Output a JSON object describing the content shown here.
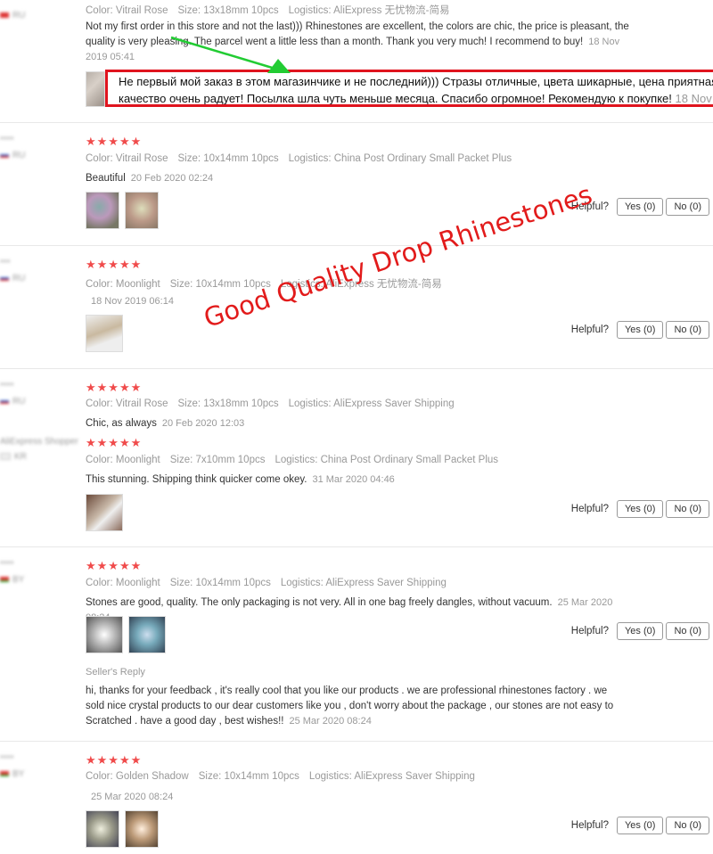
{
  "colors": {
    "star": "#f04b4b",
    "annotation": "#e0141e",
    "arrow": "#22cc33"
  },
  "helpful_label": "Helpful?",
  "reviews": [
    {
      "country": "RU",
      "stars": "",
      "color": "Color: Vitrail Rose",
      "size": "Size: 13x18mm 10pcs",
      "logistics": "Logistics: AliExpress 无忧物流-简易",
      "text": "Not my first order in this store and not the last))) Rhinestones are excellent, the colors are chic, the price is pleasant, the quality is very pleasing. The parcel went a little less than a month. Thank you very much! I recommend to buy!",
      "date": "18 Nov 2019 05:41"
    },
    {
      "country": "RU",
      "stars": "★★★★★",
      "color": "Color: Vitrail Rose",
      "size": "Size: 10x14mm 10pcs",
      "logistics": "Logistics: China Post Ordinary Small Packet Plus",
      "text": "Beautiful",
      "date": "20 Feb 2020 02:24",
      "yes": "Yes (0)",
      "no": "No (0)"
    },
    {
      "country": "RU",
      "stars": "★★★★★",
      "color": "Color: Moonlight",
      "size": "Size: 10x14mm 10pcs",
      "logistics": "Logistics: AliExpress 无忧物流-简易",
      "text": "",
      "date": "18 Nov 2019 06:14",
      "yes": "Yes (0)",
      "no": "No (0)"
    },
    {
      "country": "RU",
      "stars": "★★★★★",
      "color": "Color: Vitrail Rose",
      "size": "Size: 13x18mm 10pcs",
      "logistics": "Logistics: AliExpress Saver Shipping",
      "text": "Chic, as always",
      "date": "20 Feb 2020 12:03"
    },
    {
      "user": "AliExpress Shopper",
      "country": "KR",
      "stars": "★★★★★",
      "color": "Color: Moonlight",
      "size": "Size: 7x10mm 10pcs",
      "logistics": "Logistics: China Post Ordinary Small Packet Plus",
      "text": "This stunning. Shipping think quicker come okey.",
      "date": "31 Mar 2020 04:46",
      "yes": "Yes (0)",
      "no": "No (0)"
    },
    {
      "country": "BY",
      "stars": "★★★★★",
      "color": "Color: Moonlight",
      "size": "Size: 10x14mm 10pcs",
      "logistics": "Logistics: AliExpress Saver Shipping",
      "text": "Stones are good, quality. The only packaging is not very. All in one bag freely dangles, without vacuum.",
      "date": "25 Mar 2020 08:24",
      "yes": "Yes (0)",
      "no": "No (0)",
      "seller_label": "Seller's Reply",
      "reply": "hi, thanks for your feedback , it's really cool that you like our products . we are professional rhinestones factory . we sold nice crystal products to our dear customers like you , don't worry about the package , our stones are not easy to Scratched . have a good day , best wishes!!",
      "reply_date": "25 Mar 2020 08:24"
    },
    {
      "country": "BY",
      "stars": "★★★★★",
      "color": "Color: Golden Shadow",
      "size": "Size: 10x14mm 10pcs",
      "logistics": "Logistics: AliExpress Saver Shipping",
      "text": "",
      "date": "25 Mar 2020 08:24",
      "yes": "Yes (0)",
      "no": "No (0)"
    }
  ],
  "translation": {
    "line1": "Не первый мой заказ в этом магазинчике и не последний))) Стразы отличные, цвета шикарные, цена приятная,",
    "line2": "качество очень радует! Посылка шла чуть меньше месяца. Спасибо огромное! Рекомендую к покупке!",
    "date": "18 Nov"
  },
  "watermark": "Good Quality Drop Rhinestones"
}
